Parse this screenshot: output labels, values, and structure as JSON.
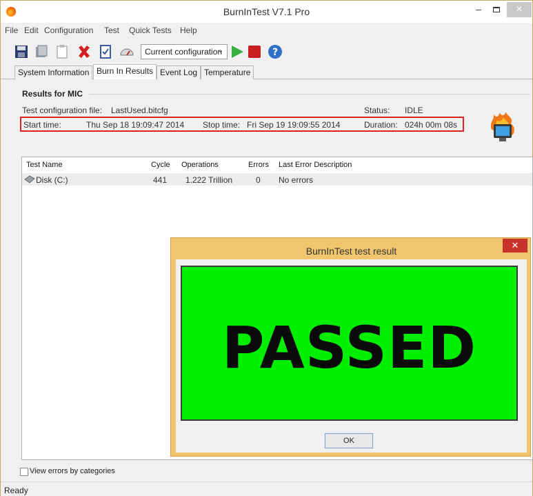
{
  "window": {
    "title": "BurnInTest V7.1 Pro",
    "minimize_symbol": "–",
    "close_symbol": "✕"
  },
  "menu": [
    "File",
    "Edit",
    "Configuration",
    "Test",
    "Quick Tests",
    "Help"
  ],
  "toolbar": {
    "icons": [
      "save-icon",
      "preferences-icon",
      "clipboard-icon",
      "delete-icon",
      "checklist-icon",
      "gauge-icon",
      "play-icon",
      "stop-icon",
      "help-icon"
    ],
    "configuration_select": "Current configuration"
  },
  "tabs": [
    {
      "label": "System Information",
      "active": false
    },
    {
      "label": "Burn In Results",
      "active": true
    },
    {
      "label": "Event Log",
      "active": false
    },
    {
      "label": "Temperature",
      "active": false
    }
  ],
  "results": {
    "title": "Results for MIC",
    "config_label": "Test configuration file:",
    "config_value": "LastUsed.bitcfg",
    "status_label": "Status:",
    "status_value": "IDLE",
    "start_label": "Start time:",
    "start_value": "Thu Sep 18 19:09:47 2014",
    "stop_label": "Stop time:",
    "stop_value": "Fri Sep 19 19:09:55 2014",
    "duration_label": "Duration:",
    "duration_value": "024h 00m 08s"
  },
  "table": {
    "columns": [
      "Test Name",
      "Cycle",
      "Operations",
      "Errors",
      "Last Error Description"
    ],
    "rows": [
      {
        "name": "Disk (C:)",
        "cycle": "441",
        "operations": "1.222 Trillion",
        "errors": "0",
        "last_error": "No errors"
      }
    ]
  },
  "view_errors_label": "View errors by categories",
  "status_bar": "Ready",
  "dialog": {
    "title": "BurnInTest test result",
    "close_symbol": "✕",
    "result": "PASSED",
    "ok_label": "OK",
    "result_color": "#00ee00"
  },
  "colors": {
    "highlight_box": "#e02020",
    "dialog_frame": "#f1c56e",
    "close_red": "#c7332b"
  }
}
